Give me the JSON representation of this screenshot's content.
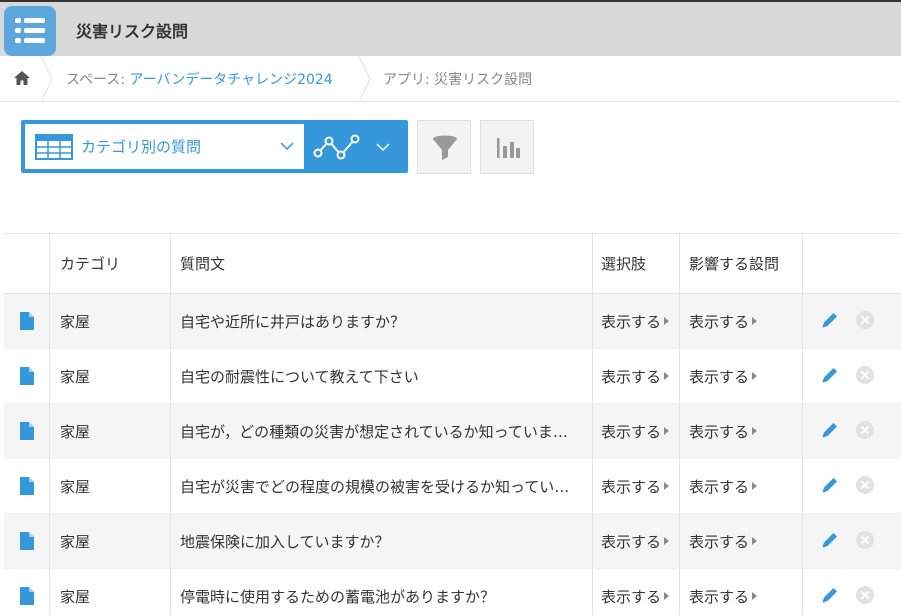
{
  "app": {
    "title": "災害リスク設問",
    "icon": "list-icon",
    "accent_color": "#3498db"
  },
  "breadcrumb": {
    "home_icon": "home-icon",
    "space_prefix": "スペース: ",
    "space_name": "アーバンデータチャレンジ2024",
    "app_prefix": "アプリ: ",
    "app_name": "災害リスク設問"
  },
  "toolbar": {
    "view_name": "カテゴリ別の質問",
    "view_icon": "table-icon",
    "graph_icon": "graph-icon",
    "filter_icon": "filter-icon",
    "chart_icon": "bar-chart-icon"
  },
  "table": {
    "columns": [
      "カテゴリ",
      "質問文",
      "選択肢",
      "影響する設問"
    ],
    "rows": [
      {
        "category": "家屋",
        "question": "自宅や近所に井戸はありますか？",
        "choices": "表示する",
        "affects": "表示する"
      },
      {
        "category": "家屋",
        "question": "自宅の耐震性について教えて下さい",
        "choices": "表示する",
        "affects": "表示する"
      },
      {
        "category": "家屋",
        "question": "自宅が，どの種類の災害が想定されているか知っていますか？",
        "choices": "表示する",
        "affects": "表示する"
      },
      {
        "category": "家屋",
        "question": "自宅が災害でどの程度の規模の被害を受けるか知っていますか？",
        "choices": "表示する",
        "affects": "表示する"
      },
      {
        "category": "家屋",
        "question": "地震保険に加入していますか？",
        "choices": "表示する",
        "affects": "表示する"
      },
      {
        "category": "家屋",
        "question": "停電時に使用するための蓄電池がありますか？",
        "choices": "表示する",
        "affects": "表示する"
      }
    ]
  }
}
